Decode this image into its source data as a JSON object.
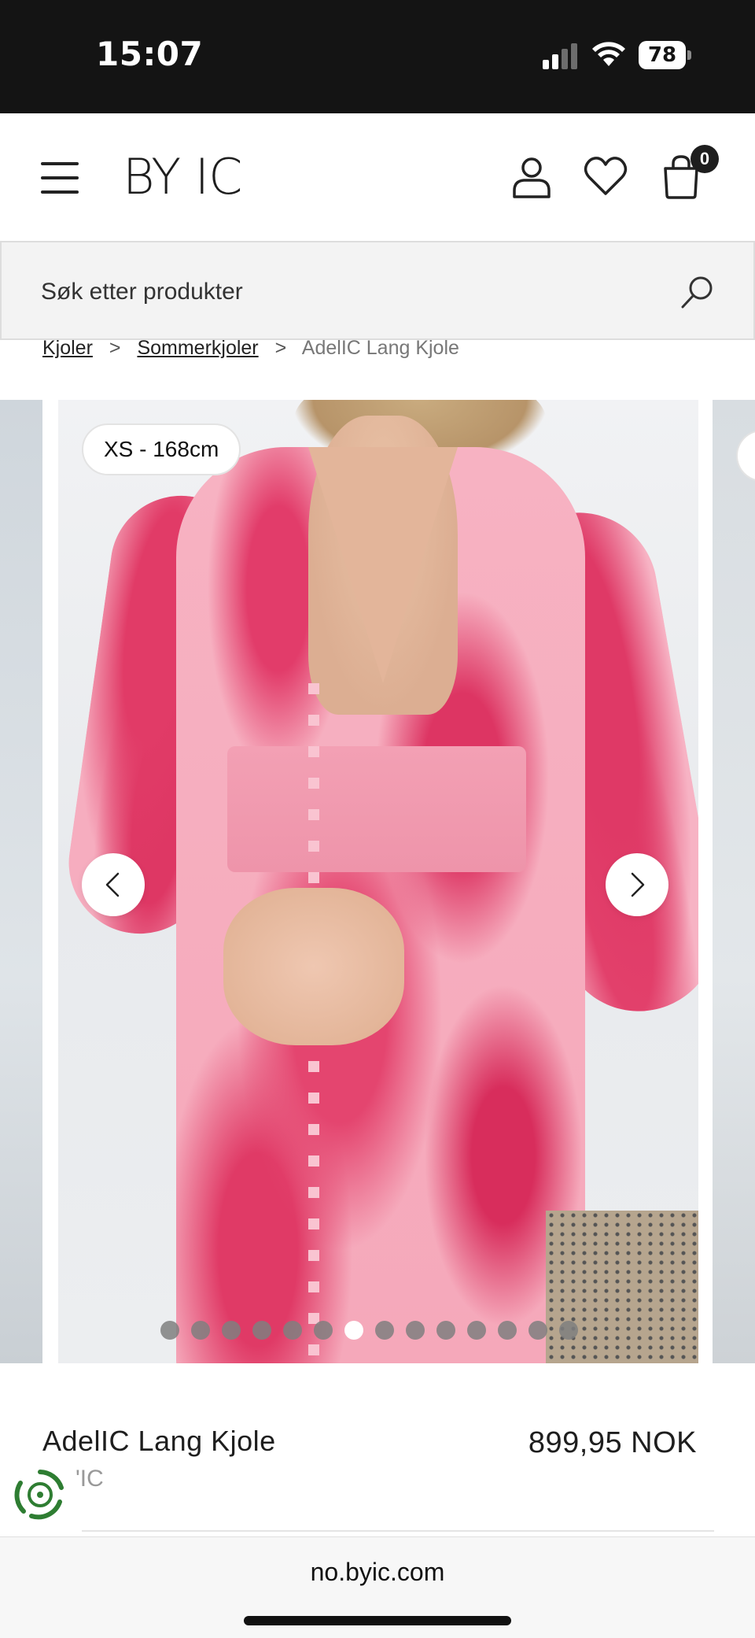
{
  "status_bar": {
    "time": "15:07",
    "battery": "78"
  },
  "header": {
    "logo": "BY IC",
    "cart_count": "0"
  },
  "search": {
    "placeholder": "Søk etter produkter"
  },
  "breadcrumb": {
    "items": [
      "Kjoler",
      "Sommerkjoler"
    ],
    "current": "AdelIC Lang Kjole",
    "separator": ">"
  },
  "gallery": {
    "size_badge": "XS - 168cm",
    "dot_count": 14,
    "active_dot": 6
  },
  "product": {
    "name": "AdelIC Lang Kjole",
    "price": "899,95 NOK",
    "brand": "'IC"
  },
  "browser": {
    "url": "no.byic.com"
  },
  "colors": {
    "header_bg": "#141414",
    "dress_pink": "#f5a8ba",
    "print_red": "#e23c6a",
    "eco_green": "#2e7d32"
  }
}
